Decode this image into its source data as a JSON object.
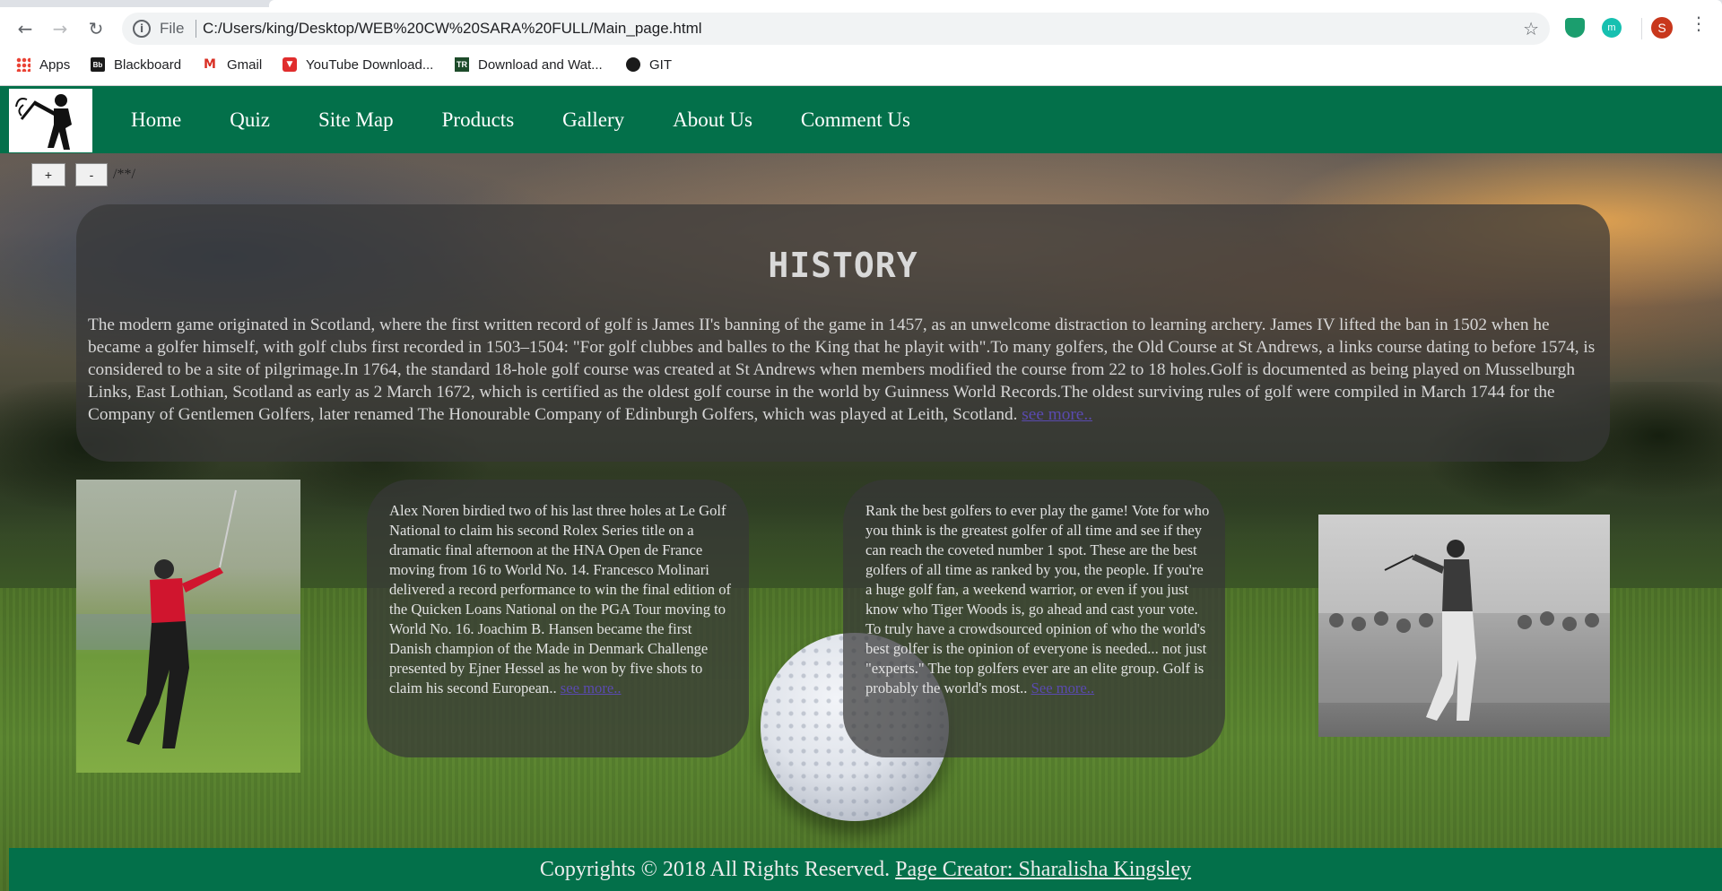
{
  "browser": {
    "scheme": "File",
    "url": "C:/Users/king/Desktop/WEB%20CW%20SARA%20FULL/Main_page.html",
    "profile_initial": "S",
    "bookmarks": [
      {
        "label": "Apps",
        "icon": "apps-grid-icon"
      },
      {
        "label": "Blackboard",
        "icon": "blackboard-icon"
      },
      {
        "label": "Gmail",
        "icon": "gmail-icon"
      },
      {
        "label": "YouTube Download...",
        "icon": "youtube-download-icon"
      },
      {
        "label": "Download and Wat...",
        "icon": "download-watch-icon"
      },
      {
        "label": "GIT",
        "icon": "github-icon"
      }
    ]
  },
  "nav": {
    "items": [
      "Home",
      "Quiz",
      "Site Map",
      "Products",
      "Gallery",
      "About Us",
      "Comment Us"
    ]
  },
  "font_controls": {
    "increase_label": "+",
    "decrease_label": "-",
    "comment": "/**/"
  },
  "history": {
    "title": "HISTORY",
    "body": "The modern game originated in Scotland, where the first written record of golf is James II's banning of the game in 1457, as an unwelcome distraction to learning archery. James IV lifted the ban in 1502 when he became a golfer himself, with golf clubs first recorded in 1503–1504: \"For golf clubbes and balles to the King that he playit with\".To many golfers, the Old Course at St Andrews, a links course dating to before 1574, is considered to be a site of pilgrimage.In 1764, the standard 18-hole golf course was created at St Andrews when members modified the course from 22 to 18 holes.Golf is documented as being played on Musselburgh Links, East Lothian, Scotland as early as 2 March 1672, which is certified as the oldest golf course in the world by Guinness World Records.The oldest surviving rules of golf were compiled in March 1744 for the Company of Gentlemen Golfers, later renamed The Honourable Company of Edinburgh Golfers, which was played at Leith, Scotland. ",
    "link": "see more.."
  },
  "cards": [
    {
      "body": "Alex Noren birdied two of his last three holes at Le Golf National to claim his second Rolex Series title on a dramatic final afternoon at the HNA Open de France moving from 16 to World No. 14. Francesco Molinari delivered a record performance to win the final edition of the Quicken Loans National on the PGA Tour moving to World No. 16. Joachim B. Hansen became the first Danish champion of the Made in Denmark Challenge presented by Ejner Hessel as he won by five shots to claim his second European.. ",
      "link": "see more.."
    },
    {
      "body": "Rank the best golfers to ever play the game! Vote for who you think is the greatest golfer of all time and see if they can reach the coveted number 1 spot. These are the best golfers of all time as ranked by you, the people. If you're a huge golf fan, a weekend warrior, or even if you just know who Tiger Woods is, go ahead and cast your vote. To truly have a crowdsourced opinion of who the world's best golfer is the opinion of everyone is needed... not just \"experts.\" The top golfers ever are an elite group. Golf is probably the world's most.. ",
      "link": "See more.."
    }
  ],
  "footer": {
    "copyright": "Copyrights © 2018 All Rights Reserved. ",
    "creator_link": "Page Creator: Sharalisha Kingsley"
  },
  "colors": {
    "brand_green": "#03704a",
    "panel": "rgba(55,55,55,0.72)",
    "link": "#5a4ab0"
  }
}
